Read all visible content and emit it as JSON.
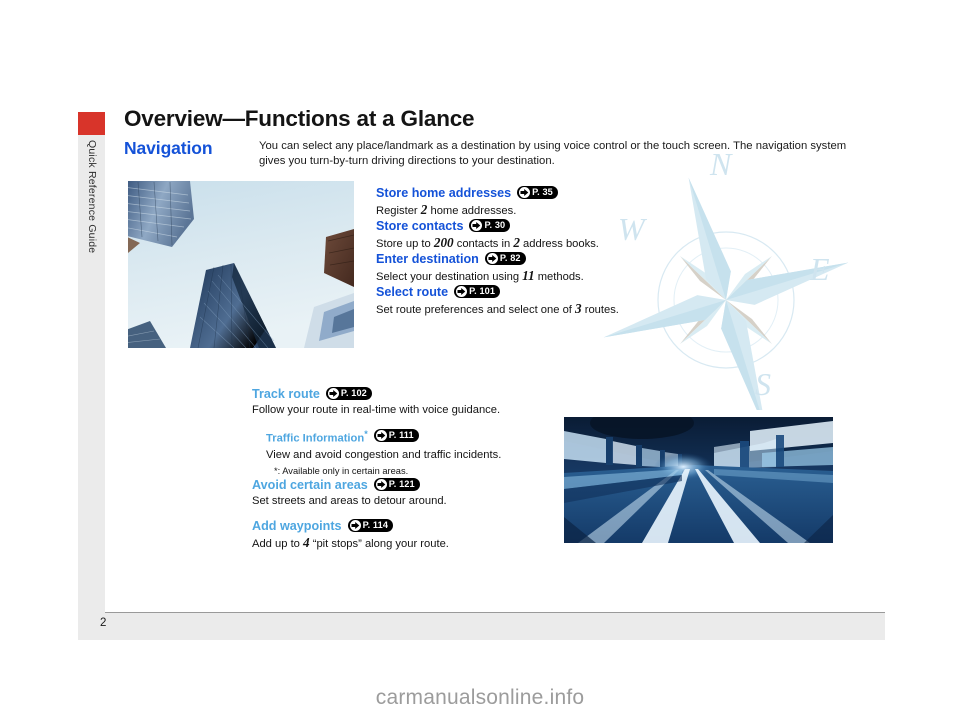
{
  "sidebar": {
    "tab_label": "Quick Reference Guide",
    "accent_color": "#d8342a"
  },
  "header": {
    "title": "Overview—Functions at a Glance"
  },
  "section": {
    "title": "Navigation",
    "intro": "You can select any place/landmark as a destination by using voice control or the touch screen. The navigation system gives you turn-by-turn driving directions to your destination."
  },
  "colors": {
    "heading_blue": "#1452d8",
    "light_blue": "#4ea6e0",
    "pill_black": "#000000",
    "sidebar_gray": "#ebebeb"
  },
  "images": {
    "buildings_alt": "skyscrapers-photo",
    "road_alt": "tunnel-road-photo",
    "compass_alt": "compass-rose-watermark"
  },
  "compass": {
    "north": "N",
    "west": "W",
    "east": "E",
    "south": "S"
  },
  "features_upper": [
    {
      "heading": "Store home addresses",
      "page_ref": "P. 35",
      "desc_pre": "Register ",
      "desc_num": "2",
      "desc_post": " home addresses."
    },
    {
      "heading": "Store contacts",
      "page_ref": "P. 30",
      "desc_pre": "Store up to ",
      "desc_num": "200",
      "desc_mid": " contacts in ",
      "desc_num2": "2",
      "desc_post": " address books."
    },
    {
      "heading": "Enter destination",
      "page_ref": "P. 82",
      "desc_pre": "Select your destination using ",
      "desc_num": "11",
      "desc_post": " methods."
    },
    {
      "heading": "Select route",
      "page_ref": "P. 101",
      "desc_pre": "Set route preferences and select one of ",
      "desc_num": "3",
      "desc_post": " routes."
    }
  ],
  "features_lower": {
    "track_route": {
      "heading": "Track route",
      "page_ref": "P. 102",
      "desc": "Follow your route in real-time with voice guidance."
    },
    "traffic_information": {
      "heading": "Traffic Information",
      "star": "*",
      "page_ref": "P. 111",
      "desc": "View and avoid congestion and traffic incidents.",
      "note": "*: Available only in certain areas."
    },
    "avoid_areas": {
      "heading": "Avoid certain areas",
      "page_ref": "P. 121",
      "desc": "Set streets and areas to detour around."
    },
    "add_waypoints": {
      "heading": "Add waypoints",
      "page_ref": "P. 114",
      "desc_pre": "Add up to ",
      "desc_num": "4",
      "desc_post": " “pit stops” along your route."
    }
  },
  "footer": {
    "page_number": "2"
  },
  "watermark": {
    "text": "carmanualsonline.info"
  }
}
